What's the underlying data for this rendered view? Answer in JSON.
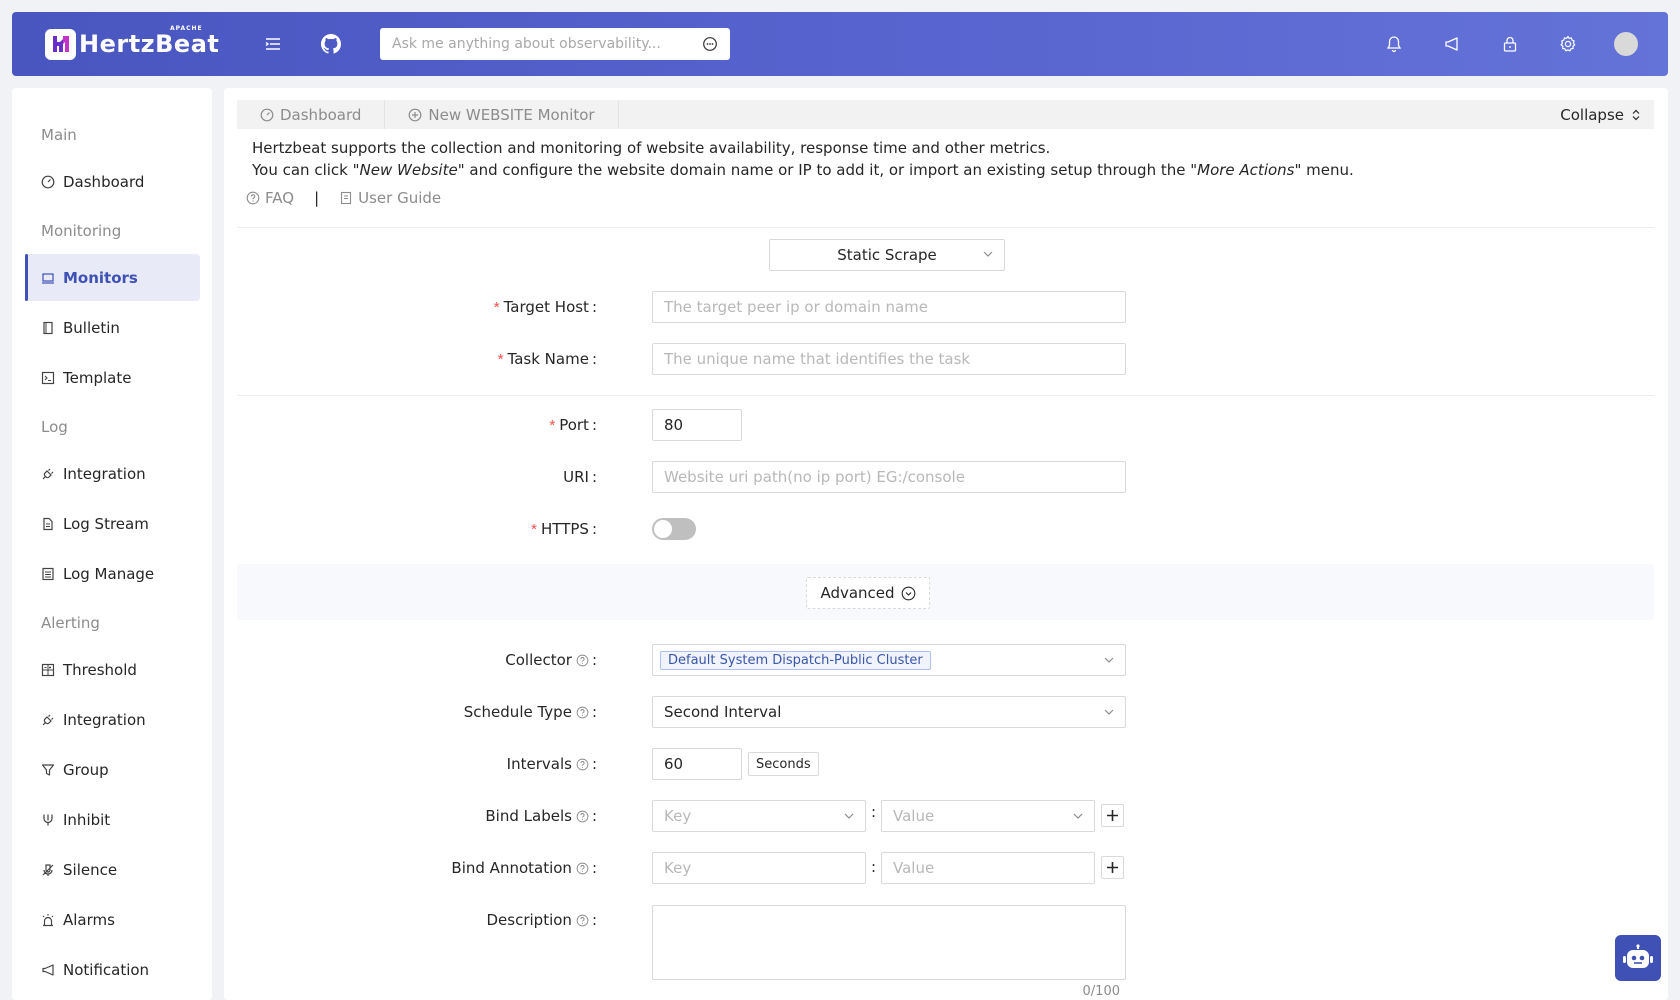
{
  "header": {
    "logo_text": "HertzBeat",
    "logo_badge": "APACHE",
    "search_placeholder": "Ask me anything about observability..."
  },
  "sidebar": {
    "groups": {
      "main": "Main",
      "monitoring": "Monitoring",
      "log": "Log",
      "alerting": "Alerting"
    },
    "items": {
      "dashboard": "Dashboard",
      "monitors": "Monitors",
      "bulletin": "Bulletin",
      "template": "Template",
      "log_integration": "Integration",
      "log_stream": "Log Stream",
      "log_manage": "Log Manage",
      "threshold": "Threshold",
      "alert_integration": "Integration",
      "group": "Group",
      "inhibit": "Inhibit",
      "silence": "Silence",
      "alarms": "Alarms",
      "notification": "Notification"
    }
  },
  "tabs": {
    "dashboard": "Dashboard",
    "new_monitor": "New WEBSITE Monitor",
    "collapse": "Collapse"
  },
  "intro": {
    "line1": "Hertzbeat supports the collection and monitoring of website availability, response time and other metrics.",
    "line2_a": "You can click \"",
    "line2_em1": "New Website",
    "line2_b": "\" and configure the website domain name or IP to add it, or import an existing setup through the \"",
    "line2_em2": "More Actions",
    "line2_c": "\" menu.",
    "faq": "FAQ",
    "separator": "|",
    "user_guide": "User Guide"
  },
  "form": {
    "scrape_mode": "Static Scrape",
    "target_host": {
      "label": "Target Host",
      "placeholder": "The target peer ip or domain name"
    },
    "task_name": {
      "label": "Task Name",
      "placeholder": "The unique name that identifies the task"
    },
    "port": {
      "label": "Port",
      "value": "80"
    },
    "uri": {
      "label": "URI",
      "placeholder": "Website uri path(no ip port) EG:/console"
    },
    "https": {
      "label": "HTTPS",
      "enabled": false
    },
    "advanced": "Advanced",
    "collector": {
      "label": "Collector",
      "value": "Default System Dispatch-Public Cluster"
    },
    "schedule_type": {
      "label": "Schedule Type",
      "value": "Second Interval"
    },
    "intervals": {
      "label": "Intervals",
      "value": "60",
      "unit": "Seconds"
    },
    "bind_labels": {
      "label": "Bind Labels",
      "key_placeholder": "Key",
      "value_placeholder": "Value"
    },
    "bind_annotation": {
      "label": "Bind Annotation",
      "key_placeholder": "Key",
      "value_placeholder": "Value"
    },
    "description": {
      "label": "Description",
      "counter": "0/100"
    },
    "colon": ":"
  },
  "colors": {
    "header_start": "#4a56c0",
    "header_end": "#6473d8",
    "primary": "#3f51b5",
    "required": "#ff4d4f"
  }
}
